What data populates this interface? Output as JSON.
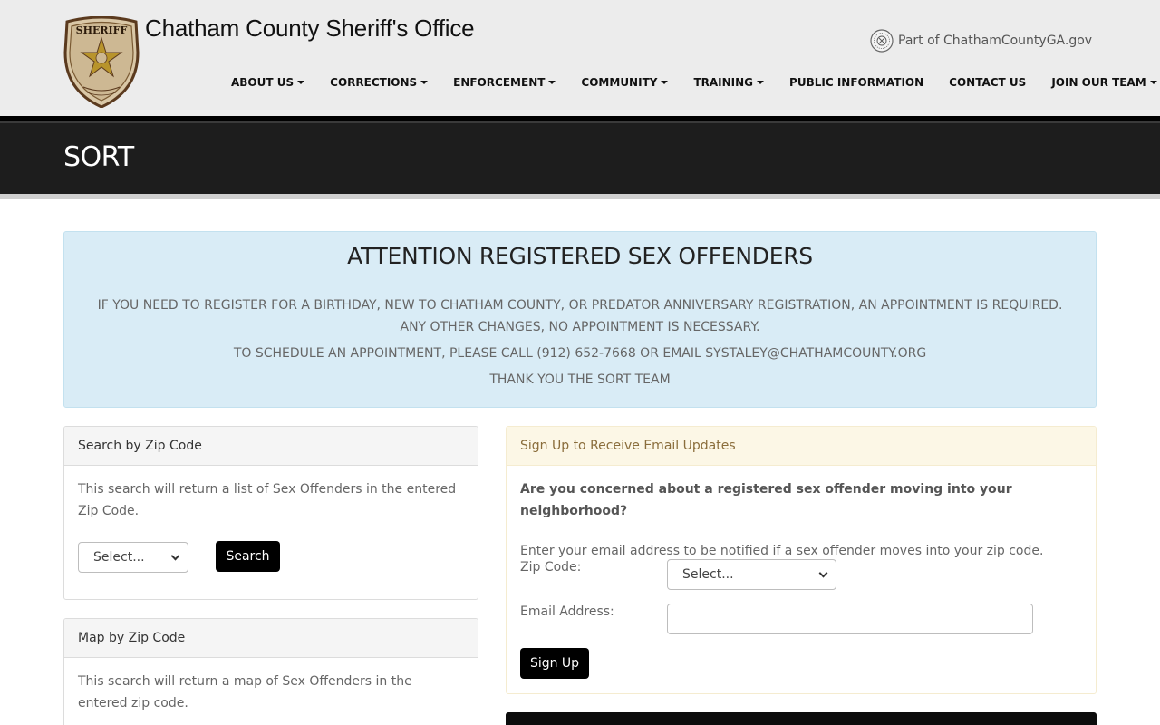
{
  "header": {
    "site_title": "Chatham County Sheriff's Office",
    "gov_link": "Part of ChathamCountyGA.gov",
    "badge_icon": "sheriff-star-badge",
    "seal_icon": "county-seal",
    "badge_text": "SHERIFF"
  },
  "nav": {
    "items": [
      {
        "label": "ABOUT US",
        "dropdown": true
      },
      {
        "label": "CORRECTIONS",
        "dropdown": true
      },
      {
        "label": "ENFORCEMENT",
        "dropdown": true
      },
      {
        "label": "COMMUNITY",
        "dropdown": true
      },
      {
        "label": "TRAINING",
        "dropdown": true
      },
      {
        "label": "PUBLIC INFORMATION",
        "dropdown": false
      },
      {
        "label": "CONTACT US",
        "dropdown": false
      },
      {
        "label": "JOIN OUR TEAM",
        "dropdown": true
      }
    ]
  },
  "banner": {
    "page_title": "SORT"
  },
  "alert": {
    "title": "ATTENTION REGISTERED SEX OFFENDERS",
    "line1": "IF YOU NEED TO REGISTER FOR A BIRTHDAY, NEW TO CHATHAM COUNTY, OR PREDATOR ANNIVERSARY REGISTRATION, AN APPOINTMENT IS REQUIRED. ANY OTHER CHANGES, NO APPOINTMENT IS NECESSARY.",
    "line2": "TO SCHEDULE AN APPOINTMENT, PLEASE CALL (912) 652-7668 OR EMAIL SYSTALEY@CHATHAMCOUNTY.ORG",
    "line3": "THANK YOU THE SORT TEAM"
  },
  "zip_search": {
    "heading": "Search by Zip Code",
    "description": "This search will return a list of Sex Offenders in the entered Zip Code.",
    "select_value": "Select...",
    "button": "Search"
  },
  "map_search": {
    "heading": "Map by Zip Code",
    "description": "This search will return a map of Sex Offenders in the entered zip code."
  },
  "email_signup": {
    "heading": "Sign Up to Receive Email Updates",
    "question": "Are you concerned about a registered sex offender moving into your neighborhood?",
    "instructions": "Enter your email address to be notified if a sex offender moves into your zip code.",
    "zip_label": "Zip Code:",
    "zip_select_value": "Select...",
    "email_label": "Email Address:",
    "email_value": "",
    "button": "Sign Up"
  },
  "colors": {
    "header_bg": "#ececec",
    "banner_bg": "#1d1d1d",
    "alert_bg": "#d9ecf6",
    "warning_heading_bg": "#fcf7e6",
    "button_bg": "#000000"
  }
}
